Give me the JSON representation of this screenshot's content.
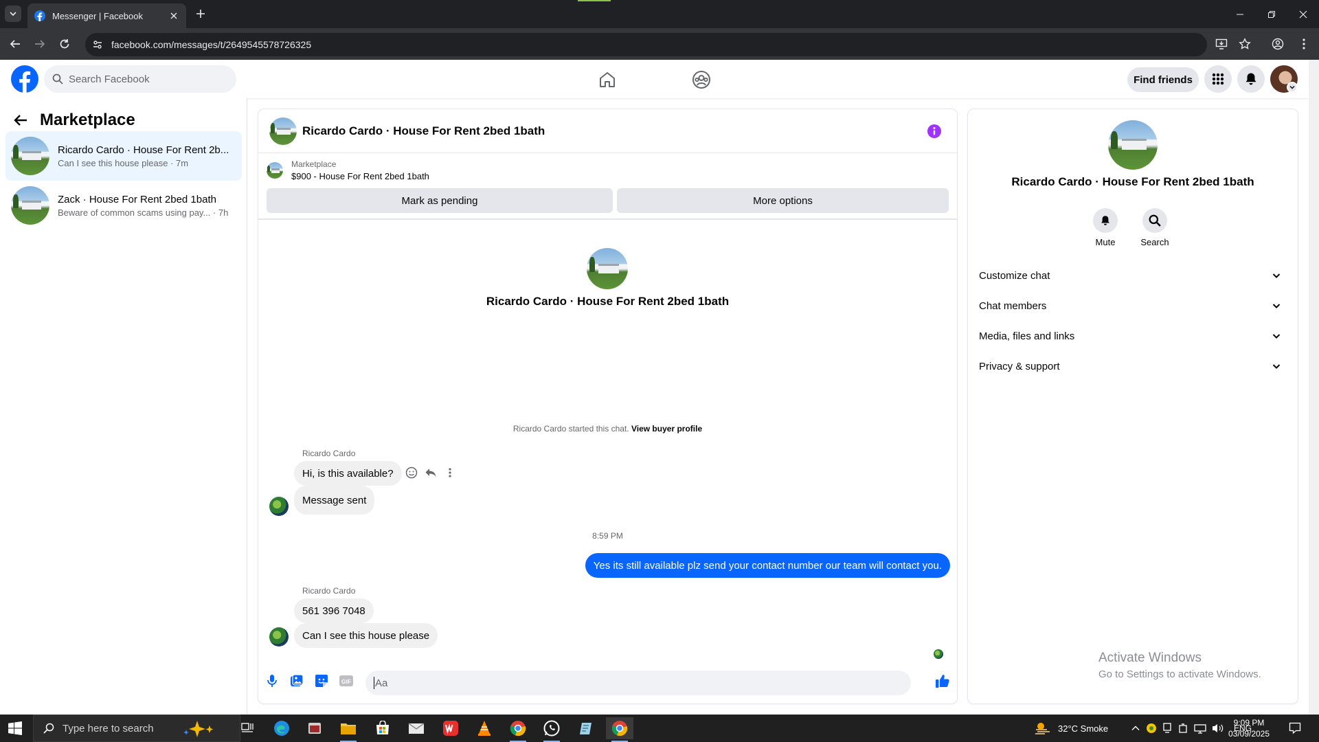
{
  "browser": {
    "tab_title": "Messenger | Facebook",
    "url": "facebook.com/messages/t/2649545578726325"
  },
  "header": {
    "search_placeholder": "Search Facebook",
    "find_friends": "Find friends"
  },
  "sidebar": {
    "title": "Marketplace",
    "conversations": [
      {
        "name": "Ricardo Cardo · House For Rent 2b...",
        "preview": "Can I see this house please · 7m",
        "active": true
      },
      {
        "name": "Zack · House For Rent 2bed 1bath",
        "preview": "Beware of common scams using pay... · 7h",
        "active": false
      }
    ]
  },
  "chat": {
    "title": "Ricardo Cardo · House For Rent 2bed 1bath",
    "marketplace_label": "Marketplace",
    "listing": "$900 - House For Rent 2bed 1bath",
    "mark_pending": "Mark as pending",
    "more_options": "More options",
    "intro_name": "Ricardo Cardo · House For Rent 2bed 1bath",
    "started_text": "Ricardo Cardo started this chat.",
    "view_buyer": "View buyer profile",
    "messages": [
      {
        "sender": "Ricardo Cardo",
        "text": "Hi, is this available?"
      },
      {
        "text": "Message sent"
      },
      {
        "timestamp": "8:59 PM"
      },
      {
        "outgoing": true,
        "text": "Yes its still available plz send your contact number our team will contact you."
      },
      {
        "sender": "Ricardo Cardo",
        "text": "561 396 7048"
      },
      {
        "text": "Can I see this house please"
      }
    ],
    "composer_placeholder": "Aa"
  },
  "info": {
    "name": "Ricardo Cardo · House For Rent 2bed 1bath",
    "mute": "Mute",
    "search": "Search",
    "sections": [
      "Customize chat",
      "Chat members",
      "Media, files and links",
      "Privacy & support"
    ],
    "activate_title": "Activate Windows",
    "activate_sub": "Go to Settings to activate Windows."
  },
  "taskbar": {
    "search_placeholder": "Type here to search",
    "weather": "32°C  Smoke",
    "lang": "ENG",
    "time": "9:09 PM",
    "date": "03/09/2025"
  },
  "colors": {
    "fb_blue": "#0866ff",
    "brand_blue": "#1877f2",
    "messenger_purple": "#a033ff",
    "active_conv_bg": "#ebf5ff"
  }
}
